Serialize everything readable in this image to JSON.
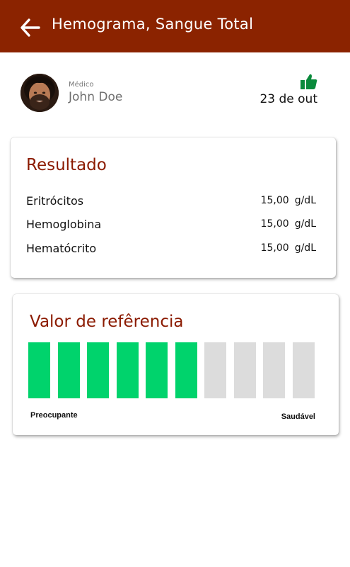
{
  "header": {
    "title": "Hemograma, Sangue Total",
    "background": "#8b2300"
  },
  "doctor": {
    "role_label": "Médico",
    "name": "John Doe"
  },
  "status": {
    "icon": "thumbs-up-icon",
    "color": "#0a8a3c",
    "date": "23 de out"
  },
  "result": {
    "title": "Resultado",
    "rows": [
      {
        "name": "Eritrócitos",
        "value": "15,00",
        "unit": "g/dL"
      },
      {
        "name": "Hemoglobina",
        "value": "15,00",
        "unit": "g/dL"
      },
      {
        "name": "Hematócrito",
        "value": "15,00",
        "unit": "g/dL"
      }
    ]
  },
  "reference": {
    "title": "Valor de refêrencia",
    "level": 6,
    "max_level": 10,
    "active_color": "#00d36c",
    "inactive_color": "#dcdcdc",
    "low_label": "Preocupante",
    "high_label": "Saudável"
  }
}
